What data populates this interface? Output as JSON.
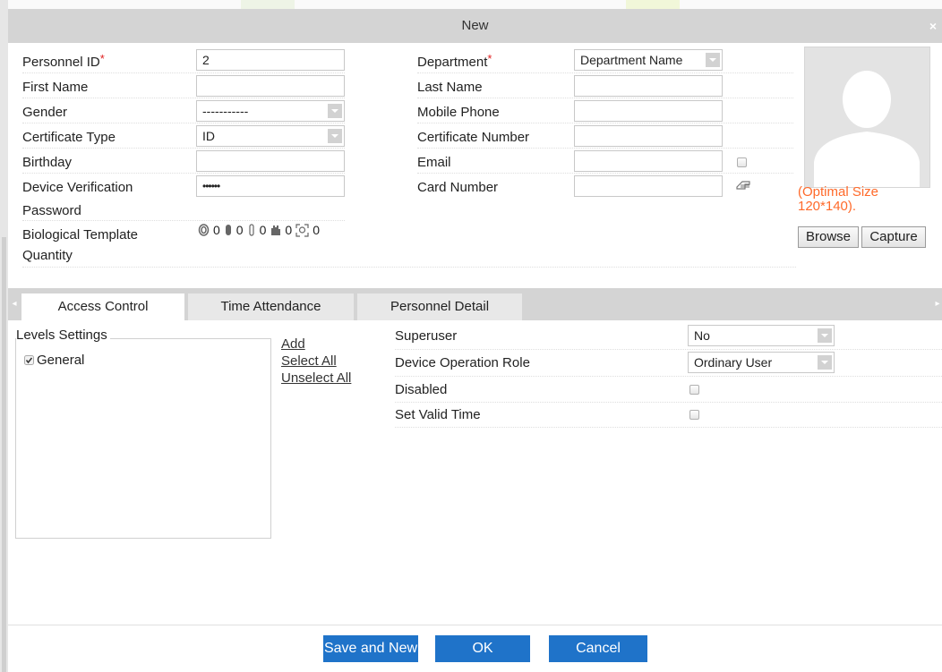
{
  "dialog": {
    "title": "New"
  },
  "personal": {
    "personnel_id_label": "Personnel ID",
    "personnel_id_value": "2",
    "first_name_label": "First Name",
    "gender_label": "Gender",
    "gender_value": "-----------",
    "certificate_type_label": "Certificate Type",
    "certificate_type_value": "ID",
    "birthday_label": "Birthday",
    "device_verification_label_1": "Device Verification",
    "device_verification_label_2": "Password",
    "device_password_value": "••••••",
    "bio_template_label_1": "Biological Template",
    "bio_template_label_2": "Quantity",
    "bio_counts": [
      "0",
      "0",
      "0",
      "0",
      "0"
    ],
    "department_label": "Department",
    "department_value": "Department Name",
    "last_name_label": "Last Name",
    "mobile_phone_label": "Mobile Phone",
    "certificate_number_label": "Certificate Number",
    "email_label": "Email",
    "card_number_label": "Card Number",
    "required_mark": "*"
  },
  "photo": {
    "hint_line_1": "(Optimal Size",
    "hint_line_2": "120*140).",
    "browse_label": "Browse",
    "capture_label": "Capture"
  },
  "tabs": [
    {
      "label": "Access Control",
      "active": true
    },
    {
      "label": "Time Attendance",
      "active": false
    },
    {
      "label": "Personnel Detail",
      "active": false
    }
  ],
  "access": {
    "levels_settings_label": "Levels Settings",
    "levels": [
      {
        "label": "General",
        "checked": true
      }
    ],
    "add_link": "Add",
    "select_all_link": "Select All",
    "unselect_all_link": "Unselect All",
    "superuser_label": "Superuser",
    "superuser_value": "No",
    "device_role_label": "Device Operation Role",
    "device_role_value": "Ordinary User",
    "disabled_label": "Disabled",
    "set_valid_time_label": "Set Valid Time"
  },
  "footer": {
    "save_new_label": "Save and New",
    "ok_label": "OK",
    "cancel_label": "Cancel"
  },
  "colors": {
    "primary_button": "#1f73c9",
    "required": "#e02020",
    "hint": "#ff6a2a",
    "titlebar": "#d4d4d4"
  }
}
